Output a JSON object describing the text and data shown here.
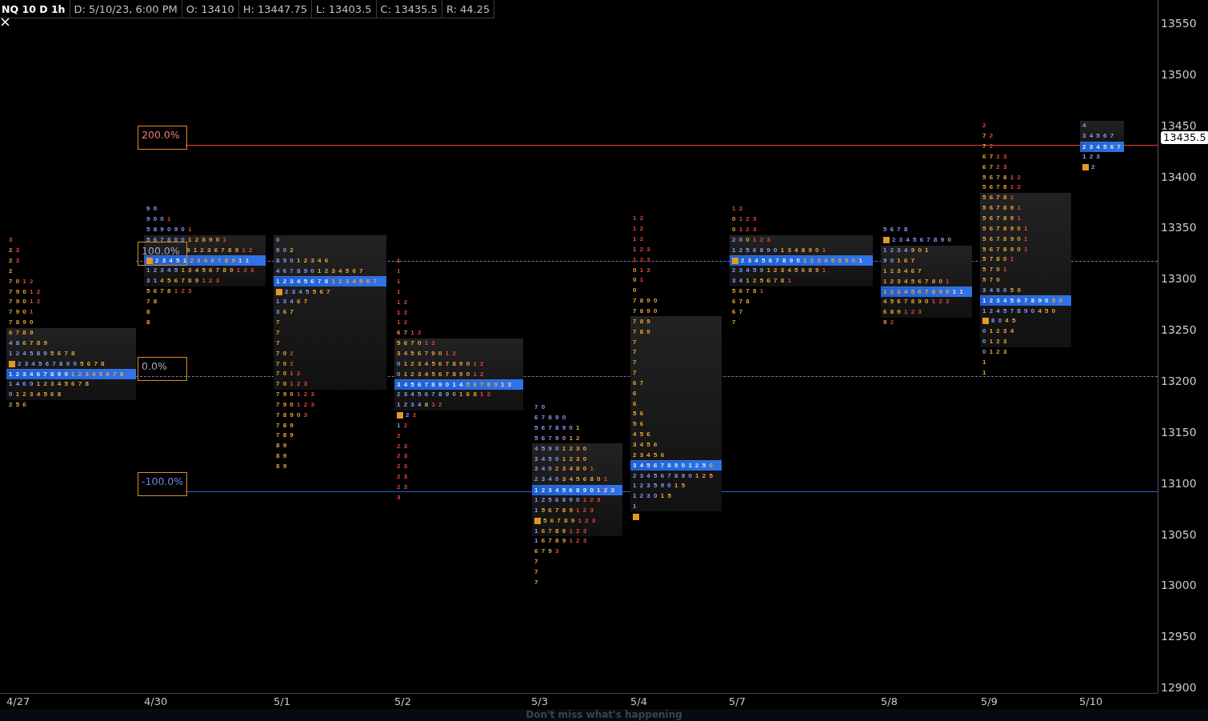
{
  "header": {
    "symbol": "NQ 10 D 1h",
    "fields": [
      "D: 5/10/23, 6:00 PM",
      "O: 13410",
      "H: 13447.75",
      "L: 13403.5",
      "C: 13435.5",
      "R: 44.25"
    ]
  },
  "levels": [
    {
      "label": "200.0%",
      "kind": "solid",
      "color": "#e5413a"
    },
    {
      "label": "100.0%",
      "kind": "dashed",
      "color": "#6e7aa8"
    },
    {
      "label": "0.0%",
      "kind": "dashed",
      "color": "#6e7aa8"
    },
    {
      "label": "-100.0%",
      "kind": "solid",
      "color": "#2e62d6"
    }
  ],
  "price_axis": {
    "ticks": [
      "13550",
      "13500",
      "13450",
      "13400",
      "13350",
      "13300",
      "13250",
      "13200",
      "13150",
      "13100",
      "13050",
      "13000",
      "12950",
      "12900"
    ],
    "last_price": "13435.5"
  },
  "date_axis": [
    "4/27",
    "4/30",
    "5/1",
    "5/2",
    "5/3",
    "5/4",
    "5/7",
    "5/8",
    "5/9",
    "5/10"
  ],
  "profiles": [
    {
      "above": [
        {
          "kind": "plain",
          "late": "3"
        },
        {
          "kind": "plain",
          "mid": "2",
          "late": "3"
        },
        {
          "kind": "plain",
          "mid": "2",
          "late": "3"
        },
        {
          "kind": "plain",
          "mid": "2"
        },
        {
          "kind": "plain",
          "mid": "7 0",
          "late": "1 2"
        },
        {
          "kind": "plain",
          "mid": "7 9 0",
          "late": "1 2"
        },
        {
          "kind": "plain",
          "mid": "7 9 0",
          "late": "1 2"
        },
        {
          "kind": "plain",
          "mid": "7 9 0",
          "late": "1"
        },
        {
          "kind": "plain",
          "mid": "7 8 9 0"
        }
      ],
      "value_area": [
        {
          "kind": "plain",
          "mid": "6 7 8 9"
        },
        {
          "kind": "plain",
          "early": "4 8",
          "mid": "6 7 8 9"
        },
        {
          "kind": "plain",
          "early": "1 2 4 5 8 9",
          "mid": "5 6 7 8"
        },
        {
          "kind": "open",
          "early": "2 3 4 5 6 7 8 9 0",
          "mid": "5 6 7 8"
        },
        {
          "kind": "poc",
          "early": "1 2 3 4 6 7 8 9 0",
          "mid": "1 2 3 4 5 6 7 8"
        },
        {
          "kind": "plain",
          "early": "1 4 6 0",
          "mid": "1 2 3 4 5 6 7 8"
        },
        {
          "kind": "plain",
          "early": "0",
          "mid": "1 2 3 4 5 6 8"
        }
      ],
      "below": [
        {
          "kind": "plain",
          "mid": "2 5 6"
        }
      ]
    },
    {
      "above": [
        {
          "kind": "plain",
          "early": "9 0"
        },
        {
          "kind": "plain",
          "early": "9 0 0",
          "late": "1"
        },
        {
          "kind": "plain",
          "early": "5 8 9 0 9 0",
          "late": "1"
        }
      ],
      "value_area": [
        {
          "kind": "plain",
          "early": "5 6 7 8 0 0",
          "mid": "1 2 8 9 0",
          "late": "1"
        },
        {
          "kind": "indented",
          "mid": "9 1 2 3 6 7 8 9",
          "late": "1 2"
        },
        {
          "kind": "poc_open",
          "early": "2 3 4 5 1",
          "mid": "2 3 4 6 7 8 9",
          "late": "1 1"
        },
        {
          "kind": "plain",
          "early": "1 2 3 4 5",
          "mid": "1 3 4 5 6 7 8 9",
          "late": "1 2 3"
        },
        {
          "kind": "plain",
          "early": "3 1",
          "mid": "4 5 6 7 8 9",
          "late": "1 2 3"
        }
      ],
      "below": [
        {
          "kind": "plain",
          "mid": "5 6 7 8",
          "late": "1 2 3"
        },
        {
          "kind": "plain",
          "mid": "7 8"
        },
        {
          "kind": "plain",
          "mid": "8"
        },
        {
          "kind": "plain",
          "mid": "8"
        }
      ]
    },
    {
      "value_area": [
        {
          "kind": "plain",
          "early": "0"
        },
        {
          "kind": "plain",
          "early": "9 0",
          "mid": "2"
        },
        {
          "kind": "plain",
          "early": "8 9 0",
          "mid": "1 2 3 4 6"
        },
        {
          "kind": "plain",
          "early": "4 6 7 8 9 0",
          "mid": "1 2 3 4 5 6 7"
        },
        {
          "kind": "poc",
          "early": "1 2 3 4 5 6 7 8",
          "mid": "1 2 3 4 5 6 7"
        },
        {
          "kind": "open",
          "early": "2 3 4 5",
          "mid": "5 6 7"
        },
        {
          "kind": "plain",
          "early": "1 3 4",
          "mid": "6 7"
        },
        {
          "kind": "plain",
          "early": "3",
          "mid": "6 7"
        },
        {
          "kind": "plain",
          "mid": "7"
        },
        {
          "kind": "plain",
          "mid": "7"
        },
        {
          "kind": "plain",
          "mid": "7"
        },
        {
          "kind": "plain",
          "mid": "7 0",
          "late": "2"
        },
        {
          "kind": "plain",
          "mid": "7 0",
          "late": "2"
        },
        {
          "kind": "plain",
          "mid": "7 0",
          "late": "1 2"
        },
        {
          "kind": "plain",
          "mid": "7 0",
          "late": "1 2 3"
        }
      ],
      "below": [
        {
          "kind": "plain",
          "mid": "7 9 0",
          "late": "1 2 3"
        },
        {
          "kind": "plain",
          "mid": "7 9 0",
          "late": "1 2 3"
        },
        {
          "kind": "plain",
          "mid": "7 8 9 0",
          "late": "3"
        },
        {
          "kind": "plain",
          "mid": "7 8 9"
        },
        {
          "kind": "plain",
          "mid": "7 8 9"
        },
        {
          "kind": "plain",
          "mid": "8 9"
        },
        {
          "kind": "plain",
          "mid": "8 9"
        },
        {
          "kind": "plain",
          "mid": "8 9"
        }
      ]
    },
    {
      "above": [
        {
          "kind": "plain",
          "late": "1"
        },
        {
          "kind": "plain",
          "late": "1"
        },
        {
          "kind": "plain",
          "late": "1"
        },
        {
          "kind": "plain",
          "late": "1"
        },
        {
          "kind": "plain",
          "late": "1 2"
        },
        {
          "kind": "plain",
          "late": "1 2"
        },
        {
          "kind": "plain",
          "late": "1 2"
        },
        {
          "kind": "plain",
          "mid": "6 7",
          "late": "1 2"
        }
      ],
      "value_area": [
        {
          "kind": "plain",
          "mid": "5 6 7 0",
          "late": "1 2"
        },
        {
          "kind": "plain",
          "mid": "3 4 5 6 7 9 0",
          "late": "1 2"
        },
        {
          "kind": "plain",
          "early": "0",
          "mid": "1 2 3 4 5 6 7 8 9 0",
          "late": "1 2"
        },
        {
          "kind": "plain",
          "early": "0",
          "mid": "1 2 3 4 5 6 7 8 9 0",
          "late": "1 2"
        },
        {
          "kind": "poc",
          "early": "3 4 5 6 7 8 9 0 1 4",
          "mid": "5 6 7 8 9",
          "late": "1 2"
        },
        {
          "kind": "plain",
          "early": "2 3 4 5 6 7 8 9 0",
          "mid": "1 6 8",
          "late": "1 2"
        },
        {
          "kind": "plain",
          "early": "1 2 3 4",
          "mid": "8",
          "late": "1 2"
        }
      ],
      "below": [
        {
          "kind": "open",
          "early": "2",
          "late": "2"
        },
        {
          "kind": "plain",
          "early": "1",
          "late": "2"
        },
        {
          "kind": "plain",
          "late": "2"
        },
        {
          "kind": "plain",
          "late": "2 3"
        },
        {
          "kind": "plain",
          "late": "2 3"
        },
        {
          "kind": "plain",
          "late": "2 3"
        },
        {
          "kind": "plain",
          "late": "2 3"
        },
        {
          "kind": "plain",
          "late": "2 3"
        },
        {
          "kind": "plain",
          "late": "3"
        }
      ]
    },
    {
      "above": [
        {
          "kind": "plain",
          "early": "7 0"
        },
        {
          "kind": "plain",
          "early": "6 7 8 9 0"
        },
        {
          "kind": "plain",
          "early": "5 6 7 8 9 0",
          "mid": "1"
        },
        {
          "kind": "plain",
          "early": "5 6 7 9 0",
          "mid": "1 2"
        }
      ],
      "value_area": [
        {
          "kind": "plain",
          "early": "4 5 9 0",
          "mid": "1 2 3 0"
        },
        {
          "kind": "plain",
          "early": "3 4 5 0",
          "mid": "1 2 3 0"
        },
        {
          "kind": "plain",
          "early": "3 4 0",
          "mid": "2 3 4 8 0",
          "late": "1"
        },
        {
          "kind": "plain",
          "early": "2 3 4 0",
          "mid": "3 4 5 6 8 0",
          "late": "1"
        },
        {
          "kind": "poc",
          "early": "1 2 3 4 5 6 8 9 0",
          "late": "1 2 3"
        },
        {
          "kind": "plain",
          "early": "1 2 5 6 8 9 0",
          "late": "1 2 3"
        },
        {
          "kind": "plain",
          "early": "1",
          "mid": "5 6 7 8 9",
          "late": "1 2 3"
        },
        {
          "kind": "open",
          "mid": "5 6 7 8 9",
          "late": "1 2 3"
        },
        {
          "kind": "plain",
          "early": "1",
          "mid": "6 7 8 9",
          "late": "1 2 3"
        }
      ],
      "below": [
        {
          "kind": "plain",
          "early": "1",
          "mid": "6 7 8 9",
          "late": "1 2 3"
        },
        {
          "kind": "plain",
          "mid": "6 7 9",
          "late": "3"
        },
        {
          "kind": "plain",
          "mid": "7"
        },
        {
          "kind": "plain",
          "mid": "7"
        },
        {
          "kind": "plain",
          "mid": "7"
        }
      ]
    },
    {
      "above": [
        {
          "kind": "plain",
          "late": "1 2"
        },
        {
          "kind": "plain",
          "late": "1 2"
        },
        {
          "kind": "plain",
          "late": "1 2"
        },
        {
          "kind": "plain",
          "late": "1 2 3"
        },
        {
          "kind": "plain",
          "late": "1 2 3"
        },
        {
          "kind": "plain",
          "mid": "0",
          "late": "1 3"
        },
        {
          "kind": "plain",
          "mid": "0",
          "late": "1"
        },
        {
          "kind": "plain",
          "mid": "0"
        },
        {
          "kind": "plain",
          "mid": "7 8 9 0"
        },
        {
          "kind": "plain",
          "mid": "7 8 9 0"
        }
      ],
      "value_area": [
        {
          "kind": "plain",
          "mid": "7 8 9"
        },
        {
          "kind": "plain",
          "mid": "7 8 9"
        },
        {
          "kind": "plain",
          "mid": "7"
        },
        {
          "kind": "plain",
          "mid": "7"
        },
        {
          "kind": "plain",
          "mid": "7"
        },
        {
          "kind": "plain",
          "mid": "7"
        },
        {
          "kind": "plain",
          "mid": "6 7"
        },
        {
          "kind": "plain",
          "mid": "6"
        },
        {
          "kind": "plain",
          "mid": "6"
        },
        {
          "kind": "plain",
          "mid": "5 6"
        },
        {
          "kind": "plain",
          "mid": "5 6"
        },
        {
          "kind": "plain",
          "mid": "4 5 6"
        },
        {
          "kind": "plain",
          "mid": "3 4 5 6"
        },
        {
          "kind": "plain",
          "mid": "2 3 4 5 6"
        },
        {
          "kind": "poc",
          "early": "3 4 5 6 7 8 9 0 1 2 5",
          "mid": "6"
        },
        {
          "kind": "plain",
          "early": "2 3 4 5 6 7 8 9 0",
          "mid": "1 2 5"
        },
        {
          "kind": "plain",
          "early": "1 2 3 5 9 0",
          "mid": "1 5"
        },
        {
          "kind": "plain",
          "early": "1 2 3 0",
          "mid": "1 5"
        },
        {
          "kind": "plain",
          "early": "1"
        }
      ],
      "below": [
        {
          "kind": "open"
        }
      ]
    },
    {
      "above": [
        {
          "kind": "plain",
          "late": "1 2"
        },
        {
          "kind": "plain",
          "mid": "0",
          "late": "1 2 3"
        },
        {
          "kind": "plain",
          "mid": "0",
          "late": "1 2 3"
        }
      ],
      "value_area": [
        {
          "kind": "plain",
          "early": "2 0",
          "mid": "0",
          "late": "1 2 3"
        },
        {
          "kind": "plain",
          "early": "1 2 5 6 8 9 0",
          "mid": "1 3 4 8 9 0",
          "late": "1"
        },
        {
          "kind": "poc_open",
          "early": "2 3 4 5 6 7 8 9 0",
          "mid": "1 2 3 4 5 8 9 0",
          "late": "1"
        },
        {
          "kind": "plain",
          "early": "2 3 4 5 9",
          "mid": "1 2 3 4 5 6 8 9",
          "late": "1"
        },
        {
          "kind": "plain",
          "early": "3 4",
          "mid": "1 2 5 6 7 8",
          "late": "1"
        }
      ],
      "below": [
        {
          "kind": "plain",
          "mid": "5 6 7 8",
          "late": "1"
        },
        {
          "kind": "plain",
          "mid": "6 7 8"
        },
        {
          "kind": "plain",
          "mid": "6 7"
        },
        {
          "kind": "plain",
          "mid": "7"
        }
      ]
    },
    {
      "above": [
        {
          "kind": "plain",
          "early": "5 6 7 8"
        },
        {
          "kind": "open",
          "early": "2 3 4 5 6 7 8 9 0"
        }
      ],
      "value_area": [
        {
          "kind": "plain",
          "early": "1 2 3 4",
          "mid": "9 0 1"
        },
        {
          "kind": "plain",
          "early": "9 0",
          "mid": "1 6 7"
        },
        {
          "kind": "plain",
          "mid": "1 2 3 4 6 7"
        },
        {
          "kind": "plain",
          "mid": "1 2 3 4 5 6 7 8 0",
          "late": "1"
        },
        {
          "kind": "poc",
          "mid": "1 2 3 4 5 6 7 8 9 0",
          "late": "1 1"
        },
        {
          "kind": "plain",
          "mid": "4 5 6 7 8 9 0",
          "late": "1 2 3"
        },
        {
          "kind": "plain",
          "mid": "6 8 9",
          "late": "1 2 3"
        }
      ],
      "below": [
        {
          "kind": "plain",
          "mid": "9",
          "late": "2"
        }
      ]
    },
    {
      "above": [
        {
          "kind": "plain",
          "late": "2"
        },
        {
          "kind": "plain",
          "mid": "7",
          "late": "2"
        },
        {
          "kind": "plain",
          "mid": "7",
          "late": "2"
        },
        {
          "kind": "plain",
          "mid": "6 7",
          "late": "2 3"
        },
        {
          "kind": "plain",
          "mid": "6 7",
          "late": "2 3"
        },
        {
          "kind": "plain",
          "mid": "5 6 7 8",
          "late": "1 2"
        },
        {
          "kind": "plain",
          "mid": "5 6 7 8",
          "late": "1 2"
        }
      ],
      "value_area": [
        {
          "kind": "plain",
          "mid": "5 6 7 8",
          "late": "1"
        },
        {
          "kind": "plain",
          "mid": "5 6 7 8 9",
          "late": "1"
        },
        {
          "kind": "plain",
          "mid": "5 6 7 8 9",
          "late": "1"
        },
        {
          "kind": "plain",
          "mid": "5 6 7 8 9 0",
          "late": "1"
        },
        {
          "kind": "plain",
          "mid": "5 6 7 8 9 0",
          "late": "1"
        },
        {
          "kind": "plain",
          "mid": "5 6 7 8 9 0",
          "late": "1"
        },
        {
          "kind": "plain",
          "mid": "5 7 8 0",
          "late": "1"
        },
        {
          "kind": "plain",
          "mid": "5 7 0",
          "late": "1"
        },
        {
          "kind": "plain",
          "mid": "5 7 0"
        },
        {
          "kind": "plain",
          "early": "3 4 9 0",
          "mid": "5 0"
        },
        {
          "kind": "poc",
          "early": "1 2 3 4 5 6 7 8 9 0",
          "mid": "5 0"
        },
        {
          "kind": "plain",
          "early": "1 2 4 5 7 8 9 0",
          "mid": "4 5 0"
        },
        {
          "kind": "open",
          "early": "8 0",
          "mid": "4 5"
        },
        {
          "kind": "plain",
          "early": "0",
          "mid": "1 2 3 4"
        },
        {
          "kind": "plain",
          "early": "0",
          "mid": "1 2 3"
        }
      ],
      "below": [
        {
          "kind": "plain",
          "early": "0",
          "mid": "1 2 3"
        },
        {
          "kind": "plain",
          "mid": "1"
        },
        {
          "kind": "plain",
          "mid": "1"
        }
      ]
    },
    {
      "value_area": [
        {
          "kind": "plain",
          "early": "4"
        },
        {
          "kind": "plain",
          "early": "3 4 5 6 7"
        },
        {
          "kind": "poc",
          "early": "2 3 4 5 6 7"
        }
      ],
      "below": [
        {
          "kind": "plain",
          "early": "1 2 3"
        },
        {
          "kind": "open",
          "early": "2"
        }
      ]
    }
  ],
  "banner": "Don't miss what's happening"
}
